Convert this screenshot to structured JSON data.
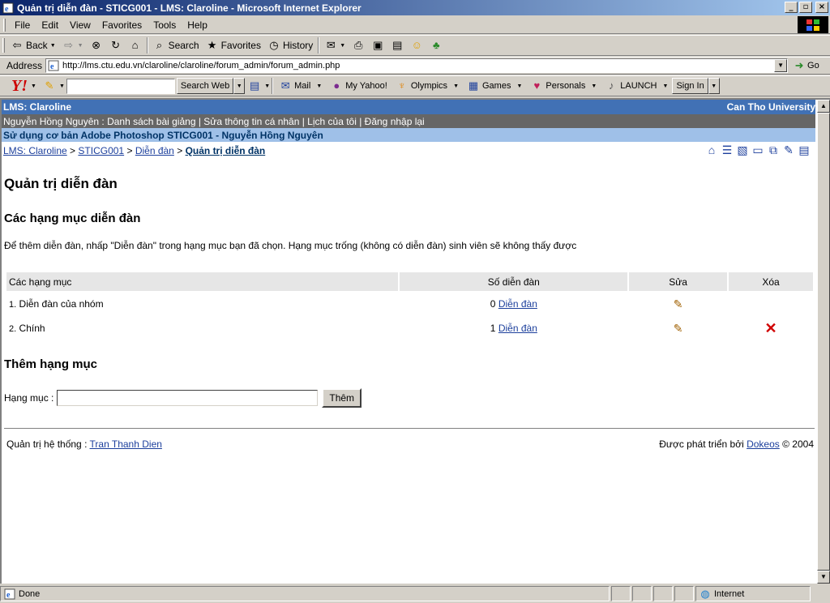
{
  "window": {
    "title": "Quản trị diễn đàn - STICG001 - LMS: Claroline - Microsoft Internet Explorer",
    "buttons": [
      "_",
      "▫",
      "×"
    ]
  },
  "menubar": {
    "items": [
      "File",
      "Edit",
      "View",
      "Favorites",
      "Tools",
      "Help"
    ]
  },
  "toolbar": {
    "back": "Back",
    "search": "Search",
    "favorites": "Favorites",
    "history": "History"
  },
  "address": {
    "label": "Address",
    "url": "http://lms.ctu.edu.vn/claroline/claroline/forum_admin/forum_admin.php",
    "go": "Go"
  },
  "yahoo": {
    "logo": "Y!",
    "search_button": "Search Web",
    "items": [
      "Mail",
      "My Yahoo!",
      "Olympics",
      "Games",
      "Personals",
      "LAUNCH"
    ],
    "sign_in": "Sign In"
  },
  "banner": {
    "site": "LMS: Claroline",
    "institution": "Can Tho University",
    "user_links": "Nguyễn Hồng Nguyên : Danh sách bài giảng | Sửa thông tin cá nhân | Lịch của tôi | Đăng nhập lại",
    "course": "Sử dụng cơ bản Adobe Photoshop STICG001 - Nguyễn Hồng Nguyên"
  },
  "breadcrumb": {
    "items": [
      "LMS: Claroline",
      "STICG001",
      "Diễn đàn"
    ],
    "separator": ">",
    "current": "Quản trị diễn đàn"
  },
  "page": {
    "title": "Quản trị diễn đàn",
    "categories_heading": "Các hạng mục diễn đàn",
    "intro": "Để thêm diễn đàn, nhấp \"Diễn đàn\" trong hạng mục bạn đã chọn. Hạng mục trống (không có diễn đàn) sinh viên sẽ không thấy được"
  },
  "table": {
    "headers": [
      "Các hạng mục",
      "Số diễn đàn",
      "Sửa",
      "Xóa"
    ],
    "rows": [
      {
        "num": "1.",
        "name": "Diễn đàn của nhóm",
        "count": "0",
        "link": "Diễn đàn",
        "deletable": false
      },
      {
        "num": "2.",
        "name": "Chính",
        "count": "1",
        "link": "Diễn đàn",
        "deletable": true
      }
    ]
  },
  "add": {
    "heading": "Thêm hạng mục",
    "label": "Hạng mục :",
    "value": "",
    "button": "Thêm"
  },
  "footer": {
    "admin_label": "Quản trị hệ thống :",
    "admin_name": "Tran Thanh Dien",
    "powered_prefix": "Được phát triển bởi",
    "powered_link": "Dokeos",
    "powered_suffix": "© 2004"
  },
  "status": {
    "text": "Done",
    "zone": "Internet"
  }
}
